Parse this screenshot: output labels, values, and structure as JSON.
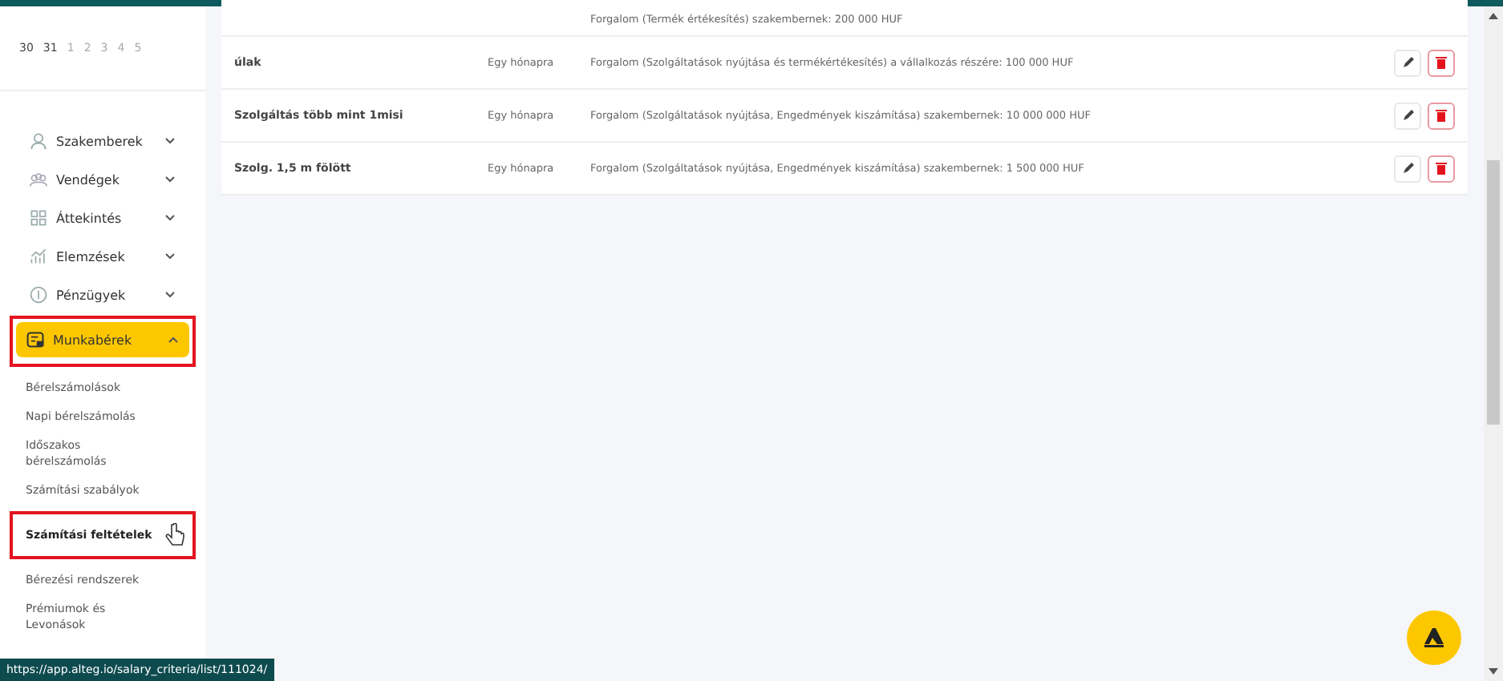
{
  "calendar": {
    "days": [
      {
        "label": "30",
        "dimmed": false
      },
      {
        "label": "31",
        "dimmed": false
      },
      {
        "label": "1",
        "dimmed": true
      },
      {
        "label": "2",
        "dimmed": true
      },
      {
        "label": "3",
        "dimmed": true
      },
      {
        "label": "4",
        "dimmed": true
      },
      {
        "label": "5",
        "dimmed": true
      }
    ]
  },
  "sidebar": {
    "items": [
      {
        "label": "Szakemberek",
        "expanded": false,
        "selected": false,
        "highlighted": false
      },
      {
        "label": "Vendégek",
        "expanded": false,
        "selected": false,
        "highlighted": false
      },
      {
        "label": "Áttekintés",
        "expanded": false,
        "selected": false,
        "highlighted": false
      },
      {
        "label": "Elemzések",
        "expanded": false,
        "selected": false,
        "highlighted": false
      },
      {
        "label": "Pénzügyek",
        "expanded": false,
        "selected": false,
        "highlighted": false
      },
      {
        "label": "Munkabérek",
        "expanded": true,
        "selected": true,
        "highlighted": true,
        "children": [
          {
            "label": "Bérelszámolások",
            "selected": false,
            "highlighted": false
          },
          {
            "label": "Napi bérelszámolás",
            "selected": false,
            "highlighted": false
          },
          {
            "label": "Időszakos bérelszámolás",
            "selected": false,
            "highlighted": false
          },
          {
            "label": "Számítási szabályok",
            "selected": false,
            "highlighted": false
          },
          {
            "label": "Számítási feltételek",
            "selected": true,
            "highlighted": true
          },
          {
            "label": "Bérezési rendszerek",
            "selected": false,
            "highlighted": false
          },
          {
            "label": "Prémiumok és Levonások",
            "selected": false,
            "highlighted": false
          }
        ]
      }
    ]
  },
  "table": {
    "rows": [
      {
        "name": "",
        "period": "",
        "condition": "Forgalom (Termék értékesítés) szakembernek: 200 000 HUF",
        "partial": true
      },
      {
        "name": "úlak",
        "period": "Egy hónapra",
        "condition": "Forgalom (Szolgáltatások nyújtása és termékértékesítés) a vállalkozás részére: 100 000 HUF",
        "partial": false
      },
      {
        "name": "Szolgáltás több mint 1misi",
        "period": "Egy hónapra",
        "condition": "Forgalom (Szolgáltatások nyújtása, Engedmények kiszámítása) szakembernek: 10 000 000 HUF",
        "partial": false
      },
      {
        "name": "Szolg. 1,5 m fölött",
        "period": "Egy hónapra",
        "condition": "Forgalom (Szolgáltatások nyújtása, Engedmények kiszámítása) szakembernek: 1 500 000 HUF",
        "partial": false
      }
    ]
  },
  "status_bar": {
    "url": "https://app.alteg.io/salary_criteria/list/111024/"
  }
}
